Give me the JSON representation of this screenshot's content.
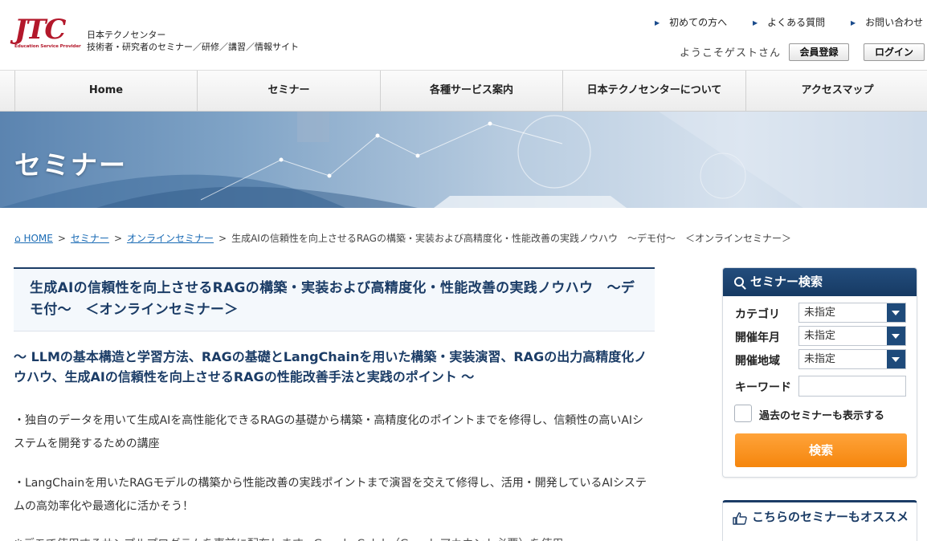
{
  "header": {
    "logo_text": "JTC",
    "logo_sub": "Education Service Provider",
    "site_name_1": "日本テクノセンター",
    "site_name_2": "技術者・研究者のセミナー／研修／講習／情報サイト",
    "toplinks": [
      "初めての方へ",
      "よくある質問",
      "お問い合わせ"
    ],
    "welcome": "ようこそゲストさん",
    "register_label": "会員登録",
    "login_label": "ログイン"
  },
  "nav": [
    "Home",
    "セミナー",
    "各種サービス案内",
    "日本テクノセンターについて",
    "アクセスマップ"
  ],
  "banner": {
    "title": "セミナー"
  },
  "breadcrumb": {
    "home": "HOME",
    "seminar": "セミナー",
    "online": "オンラインセミナー",
    "current": "生成AIの信頼性を向上させるRAGの構築・実装および高精度化・性能改善の実践ノウハウ　～デモ付～　＜オンラインセミナー＞"
  },
  "main": {
    "title": "生成AIの信頼性を向上させるRAGの構築・実装および高精度化・性能改善の実践ノウハウ　～デモ付～　＜オンラインセミナー＞",
    "subtitle": "～ LLMの基本構造と学習方法、RAGの基礎とLangChainを用いた構築・実装演習、RAGの出力高精度化ノウハウ、生成AIの信頼性を向上させるRAGの性能改善手法と実践のポイント ～",
    "para1": "・独自のデータを用いて生成AIを高性能化できるRAGの基礎から構築・高精度化のポイントまでを修得し、信頼性の高いAIシステムを開発するための講座",
    "para2": "・LangChainを用いたRAGモデルの構築から性能改善の実践ポイントまで演習を交えて修得し、活用・開発しているAIシステムの高効率化や最適化に活かそう！",
    "para3": "※デモで使用するサンプルプログラムを事前に配布します。Google Colab（Googleアカウント必要）を使用"
  },
  "search": {
    "header": "セミナー検索",
    "category_label": "カテゴリ",
    "category_value": "未指定",
    "date_label": "開催年月",
    "date_value": "未指定",
    "region_label": "開催地域",
    "region_value": "未指定",
    "keyword_label": "キーワード",
    "keyword_value": "",
    "past_label": "過去のセミナーも表示する",
    "button_label": "検索"
  },
  "recommend": {
    "title": "こちらのセミナーもオススメ"
  },
  "colors": {
    "brand": "#b3182b",
    "navy": "#1b3c66",
    "link": "#1a6bb5",
    "button": "#f5860d"
  }
}
